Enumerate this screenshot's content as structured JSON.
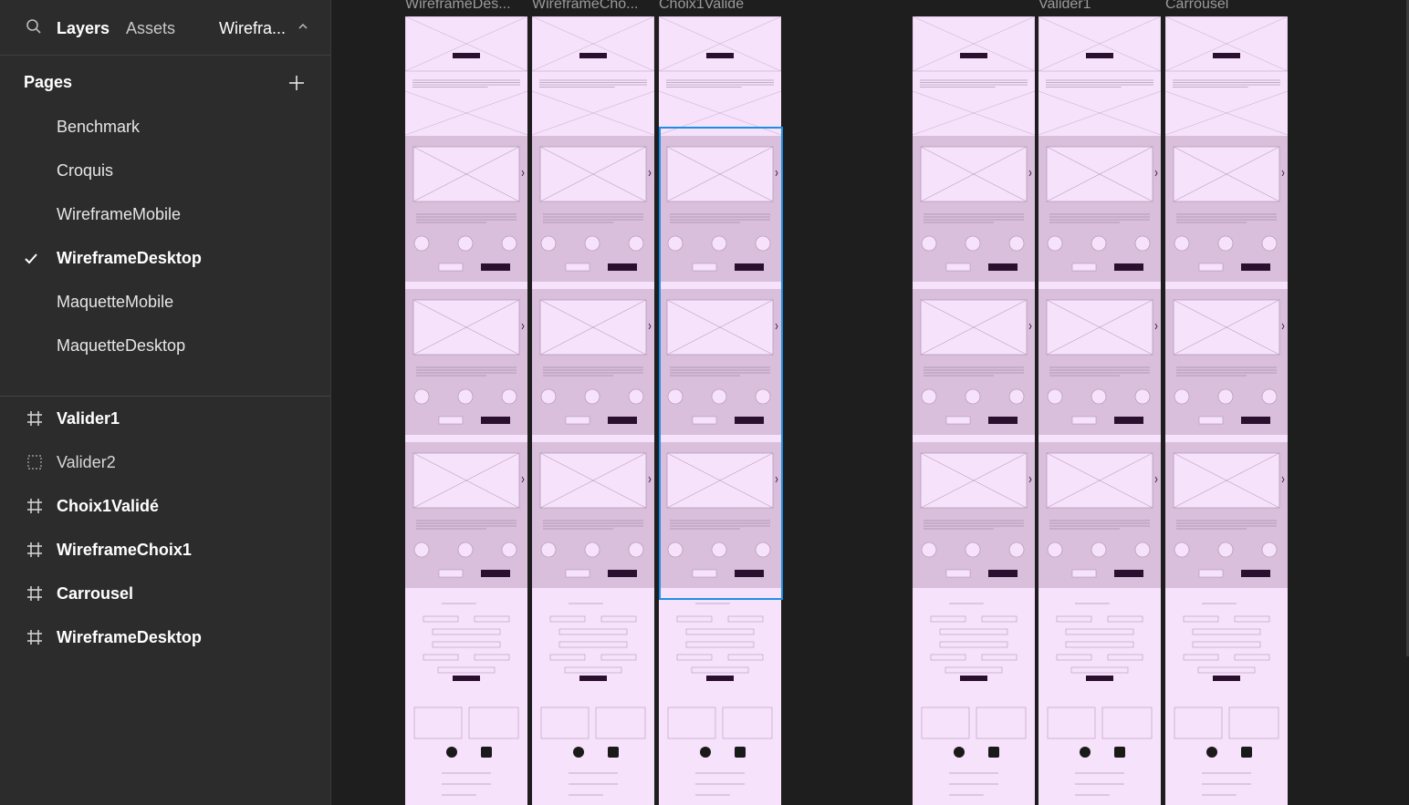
{
  "header": {
    "tabs": [
      {
        "label": "Layers"
      },
      {
        "label": "Assets"
      }
    ],
    "current_page": "Wirefra..."
  },
  "pages": {
    "title": "Pages",
    "items": [
      {
        "label": "Benchmark",
        "active": false
      },
      {
        "label": "Croquis",
        "active": false
      },
      {
        "label": "WireframeMobile",
        "active": false
      },
      {
        "label": "WireframeDesktop",
        "active": true
      },
      {
        "label": "MaquetteMobile",
        "active": false
      },
      {
        "label": "MaquetteDesktop",
        "active": false
      }
    ]
  },
  "layers": [
    {
      "label": "Valider1",
      "icon": "frame-icon"
    },
    {
      "label": "Valider2",
      "icon": "hidden-frame-icon"
    },
    {
      "label": "Choix1Validé",
      "icon": "frame-icon"
    },
    {
      "label": "WireframeChoix1",
      "icon": "frame-icon"
    },
    {
      "label": "Carrousel",
      "icon": "frame-icon"
    },
    {
      "label": "WireframeDesktop",
      "icon": "frame-icon"
    }
  ],
  "canvas": {
    "frames": [
      {
        "label": "WireframeDes..."
      },
      {
        "label": "WireframeCho..."
      },
      {
        "label": "Choix1Validé",
        "selected": true
      },
      {
        "label": ""
      },
      {
        "label": "Valider1"
      },
      {
        "label": "Carrousel"
      }
    ]
  },
  "colors": {
    "panel_bg": "#2c2c2c",
    "canvas_bg": "#1e1e1e",
    "frame_bg": "#f6e2fb",
    "section_bg": "#d9bfdc",
    "selection": "#1d8fe6"
  }
}
